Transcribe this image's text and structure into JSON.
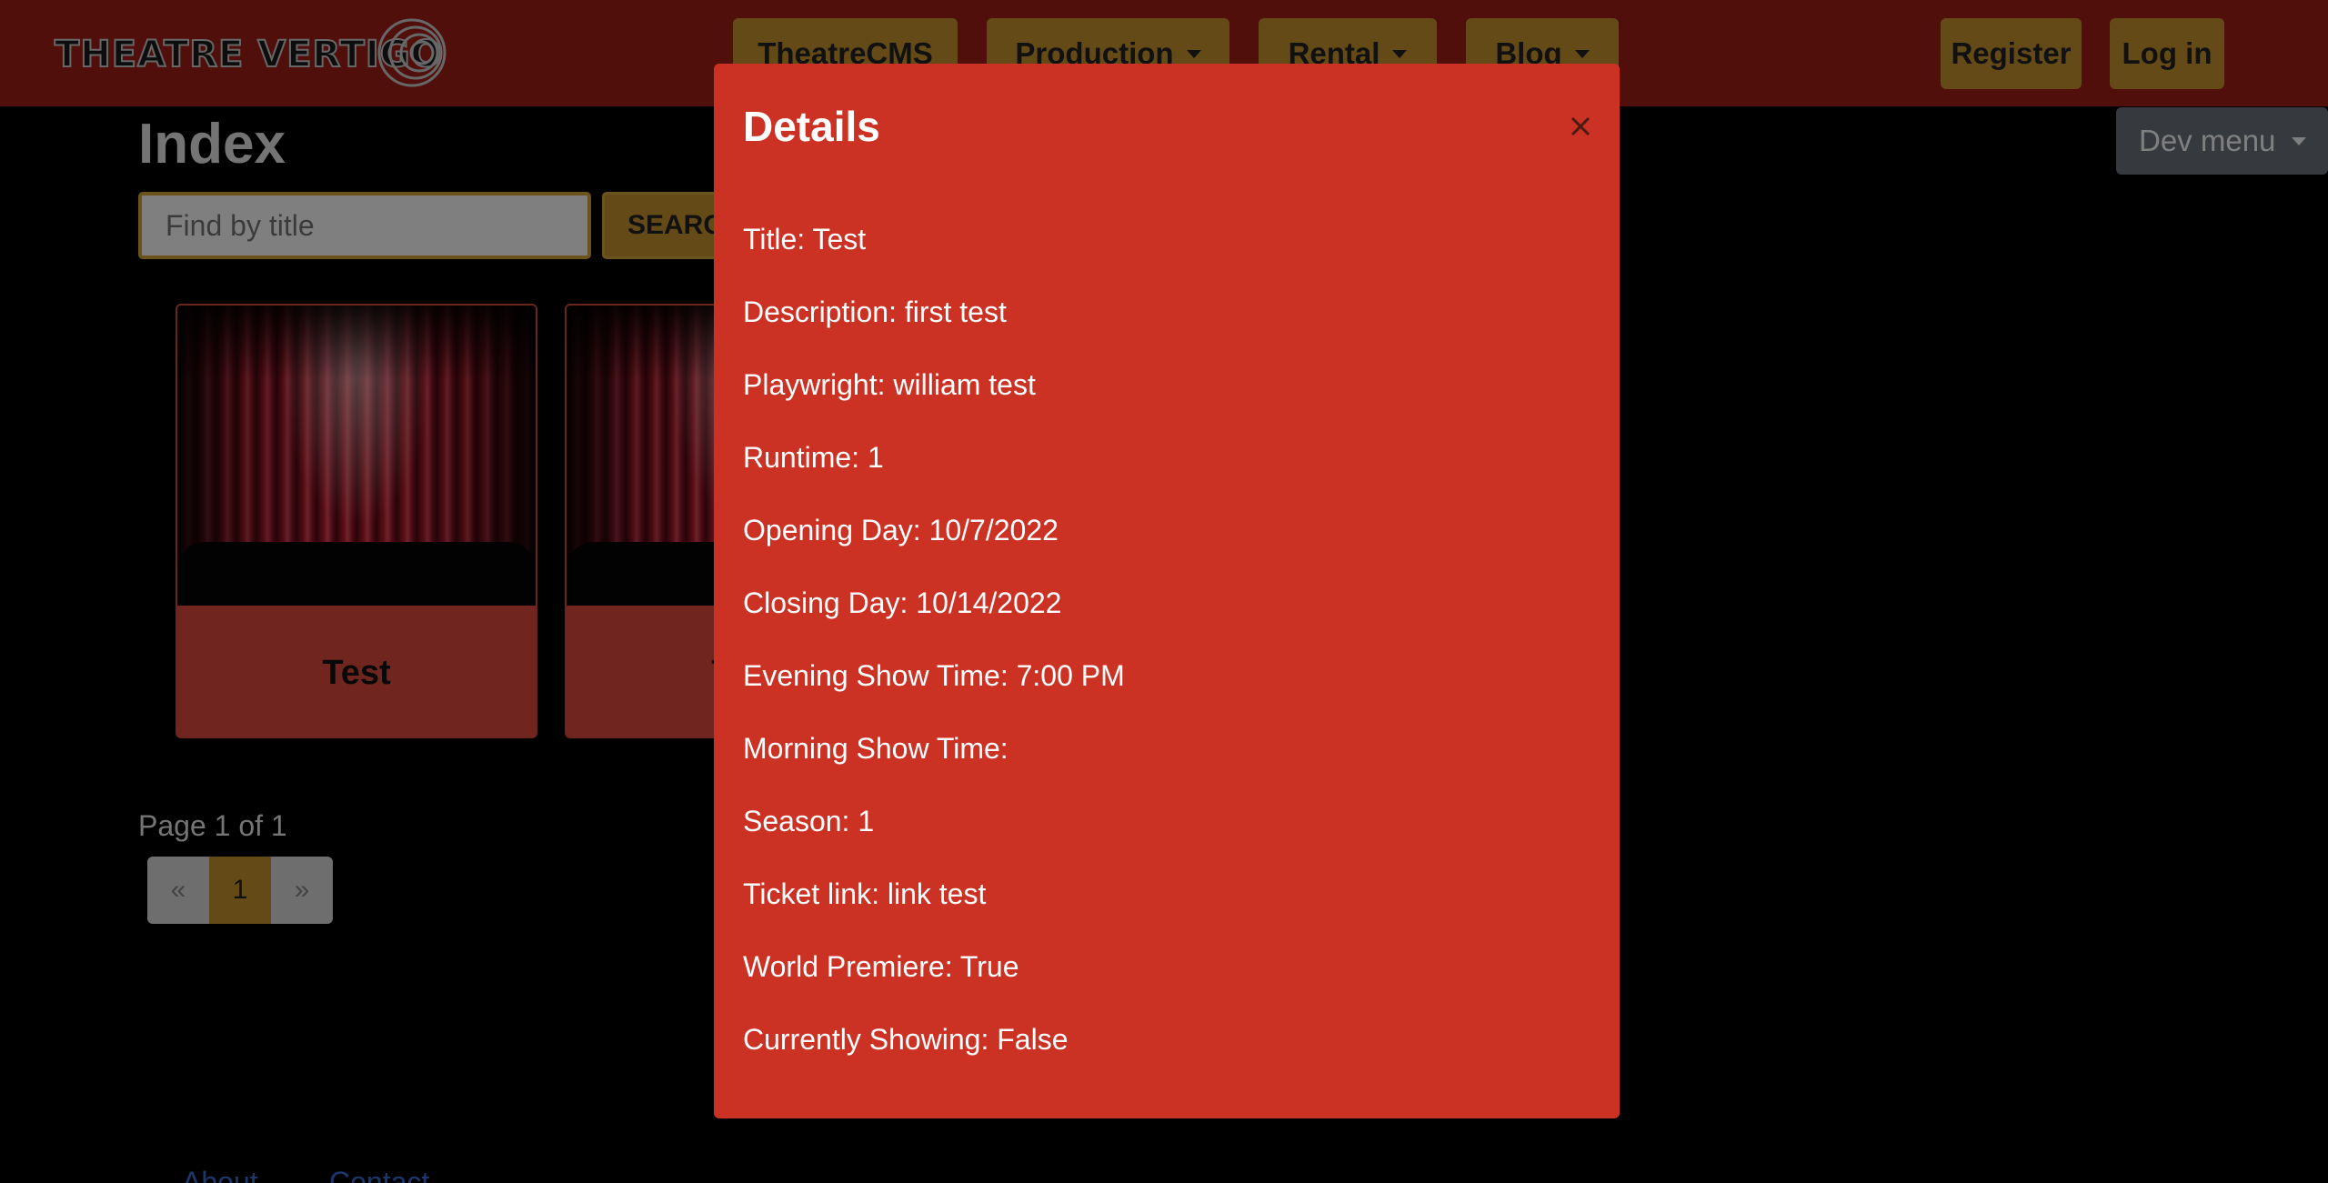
{
  "brand": {
    "logo_text": "THEATRE VERTIGO"
  },
  "nav": {
    "theatrecms": "TheatreCMS",
    "production": "Production",
    "rental": "Rental",
    "blog": "Blog",
    "register": "Register",
    "login": "Log in",
    "dev_menu": "Dev menu"
  },
  "page": {
    "title": "Index",
    "search": {
      "placeholder": "Find by title",
      "button": "SEARCH"
    },
    "cards": [
      {
        "title": "Test"
      },
      {
        "title": "Test"
      }
    ],
    "pagination": {
      "summary": "Page 1 of 1",
      "prev": "«",
      "current": "1",
      "next": "»"
    },
    "footer": {
      "about": "About",
      "contact": "Contact"
    }
  },
  "modal": {
    "title": "Details",
    "close_label": "×",
    "fields": [
      "Title: Test",
      "Description: first test",
      "Playwright: william test",
      "Runtime: 1",
      "Opening Day: 10/7/2022",
      "Closing Day: 10/14/2022",
      "Evening Show Time: 7:00 PM",
      "Morning Show Time:",
      "Season: 1",
      "Ticket link: link test",
      "World Premiere: True",
      "Currently Showing: False"
    ]
  },
  "colors": {
    "navbar": "#a01f14",
    "nav_button": "#c7952f",
    "modal": "#cc3224",
    "dev_menu": "#6c757d"
  }
}
